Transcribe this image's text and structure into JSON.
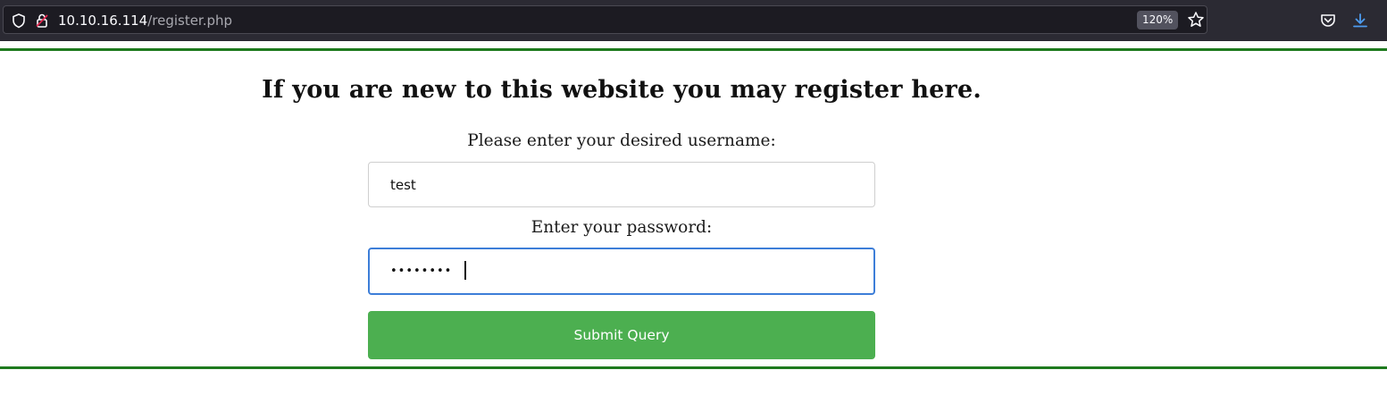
{
  "browser": {
    "url_host": "10.10.16.114",
    "url_path": "/register.php",
    "zoom_level": "120%",
    "icons": [
      "shield-icon",
      "lock-icon",
      "star-icon",
      "pocket-icon",
      "download-icon"
    ]
  },
  "page": {
    "heading": "If you are new to this website you may register here.",
    "username_label": "Please enter your desired username:",
    "username_value": "test",
    "password_label": "Enter your password:",
    "password_value": "password",
    "submit_label": "Submit Query"
  },
  "colors": {
    "rule": "#1e7a1e",
    "submit_bg": "#4caf50",
    "focus_border": "#3d7ed8"
  }
}
